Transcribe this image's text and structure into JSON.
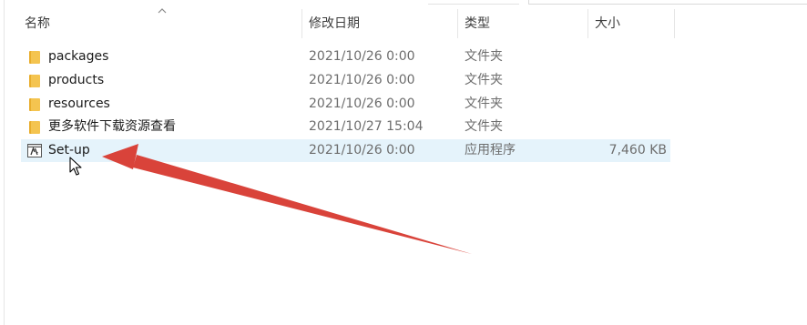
{
  "columns": {
    "name": "名称",
    "modified": "修改日期",
    "type": "类型",
    "size": "大小"
  },
  "files": [
    {
      "name": "packages",
      "modified": "2021/10/26 0:00",
      "type": "文件夹",
      "size": "",
      "icon": "folder-icon"
    },
    {
      "name": "products",
      "modified": "2021/10/26 0:00",
      "type": "文件夹",
      "size": "",
      "icon": "folder-icon"
    },
    {
      "name": "resources",
      "modified": "2021/10/26 0:00",
      "type": "文件夹",
      "size": "",
      "icon": "folder-icon"
    },
    {
      "name": "更多软件下载资源查看",
      "modified": "2021/10/27 15:04",
      "type": "文件夹",
      "size": "",
      "icon": "folder-icon"
    },
    {
      "name": "Set-up",
      "modified": "2021/10/26 0:00",
      "type": "应用程序",
      "size": "7,460 KB",
      "icon": "adobe-installer-icon",
      "selected": true
    }
  ],
  "colors": {
    "selection": "#e5f3fb",
    "folder": "#f4c450",
    "annotation_arrow": "#d9433a"
  },
  "sort": {
    "column": "name",
    "direction": "ascending"
  }
}
